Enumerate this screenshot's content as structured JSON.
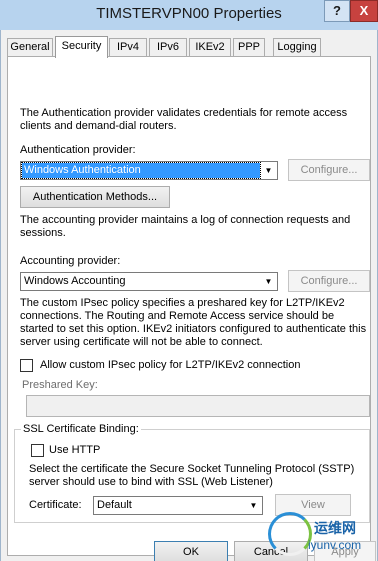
{
  "window": {
    "title": "TIMSTERVPN00 Properties",
    "help_glyph": "?",
    "close_glyph": "X"
  },
  "tabs": [
    {
      "label": "General"
    },
    {
      "label": "Security"
    },
    {
      "label": "IPv4"
    },
    {
      "label": "IPv6"
    },
    {
      "label": "IKEv2"
    },
    {
      "label": "PPP"
    },
    {
      "label": "Logging"
    }
  ],
  "security": {
    "auth_description": "The Authentication provider validates credentials for remote access clients and demand-dial routers.",
    "auth_provider_label": "Authentication provider:",
    "auth_provider_value": "Windows Authentication",
    "auth_configure_label": "Configure...",
    "auth_methods_label": "Authentication Methods...",
    "accounting_description": "The accounting provider maintains a log of connection requests and sessions.",
    "accounting_provider_label": "Accounting provider:",
    "accounting_provider_value": "Windows Accounting",
    "accounting_configure_label": "Configure...",
    "ipsec_description": "The custom IPsec policy specifies a preshared key for L2TP/IKEv2 connections. The Routing and Remote Access service should be started to set this option. IKEv2 initiators configured to authenticate this server using certificate will not be able to connect.",
    "ipsec_checkbox_label": "Allow custom IPsec policy for L2TP/IKEv2 connection",
    "ipsec_checked": false,
    "preshared_key_label": "Preshared Key:",
    "preshared_key_value": "",
    "ssl": {
      "group_label": "SSL Certificate Binding:",
      "use_http_label": "Use HTTP",
      "use_http_checked": false,
      "description": "Select the certificate the Secure Socket Tunneling Protocol (SSTP) server should use to bind with SSL (Web Listener)",
      "certificate_label": "Certificate:",
      "certificate_value": "Default",
      "view_label": "View"
    }
  },
  "footer": {
    "ok_label": "OK",
    "cancel_label": "Cancel",
    "apply_label": "Apply"
  },
  "watermark": {
    "cn_text": "运维网",
    "url_text": "iyunv.com"
  },
  "colors": {
    "titlebar": "#b7d3ee",
    "close_button": "#c7423f",
    "selection": "#3399ff"
  }
}
